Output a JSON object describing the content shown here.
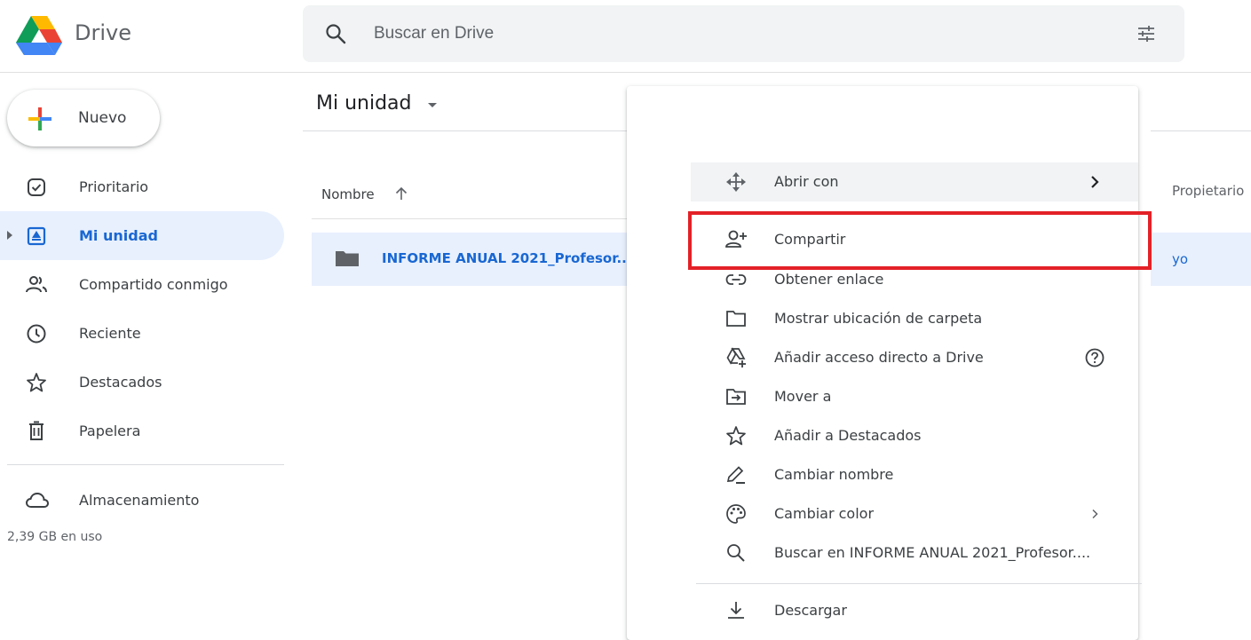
{
  "app": {
    "name": "Drive"
  },
  "search": {
    "placeholder": "Buscar en Drive"
  },
  "sidebar": {
    "new_label": "Nuevo",
    "items": [
      {
        "label": "Prioritario",
        "icon": "priority-icon",
        "active": false
      },
      {
        "label": "Mi unidad",
        "icon": "my-drive-icon",
        "active": true
      },
      {
        "label": "Compartido conmigo",
        "icon": "shared-icon",
        "active": false
      },
      {
        "label": "Reciente",
        "icon": "clock-icon",
        "active": false
      },
      {
        "label": "Destacados",
        "icon": "star-icon",
        "active": false
      },
      {
        "label": "Papelera",
        "icon": "trash-icon",
        "active": false
      }
    ],
    "storage_label": "Almacenamiento",
    "storage_usage": "2,39 GB en uso"
  },
  "main": {
    "title": "Mi unidad",
    "columns": {
      "name": "Nombre",
      "owner": "Propietario"
    },
    "file": {
      "name": "INFORME ANUAL 2021_Profesor....",
      "owner": "yo"
    }
  },
  "context_menu": {
    "items": [
      {
        "label": "Abrir con",
        "icon": "move-arrows-icon",
        "submenu": true
      },
      {
        "label": "Compartir",
        "icon": "person-add-icon",
        "submenu": false
      },
      {
        "label": "Obtener enlace",
        "icon": "link-icon",
        "submenu": false
      },
      {
        "label": "Mostrar ubicación de carpeta",
        "icon": "folder-outline-icon",
        "submenu": false
      },
      {
        "label": "Añadir acceso directo a Drive",
        "icon": "drive-shortcut-icon",
        "help": true
      },
      {
        "label": "Mover a",
        "icon": "move-folder-icon",
        "submenu": false
      },
      {
        "label": "Añadir a Destacados",
        "icon": "star-icon",
        "submenu": false
      },
      {
        "label": "Cambiar nombre",
        "icon": "pencil-icon",
        "submenu": false
      },
      {
        "label": "Cambiar color",
        "icon": "palette-icon",
        "submenu": true
      },
      {
        "label": "Buscar en INFORME ANUAL 2021_Profesor....",
        "icon": "search-icon",
        "submenu": false
      },
      {
        "label": "Descargar",
        "icon": "download-icon",
        "submenu": false
      }
    ]
  },
  "colors": {
    "accent": "#1967d2",
    "selected_bg": "#e8f0fe",
    "highlight_border": "#e32127"
  }
}
